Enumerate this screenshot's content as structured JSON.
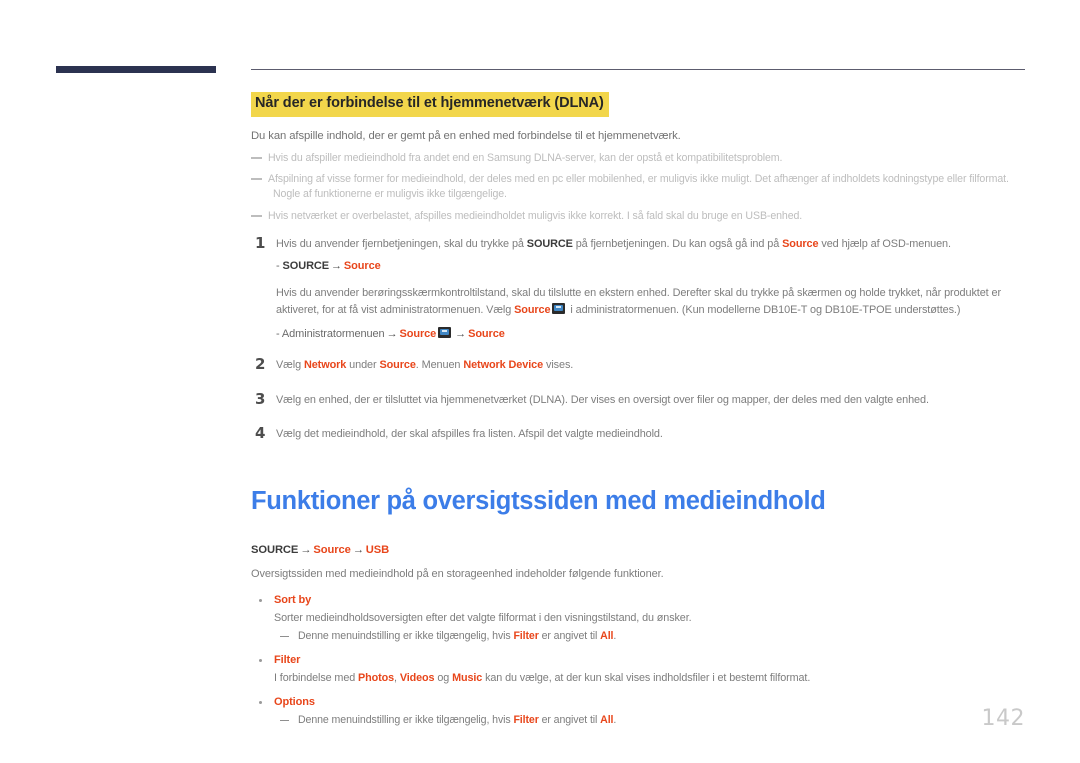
{
  "colors": {
    "highlight_yellow": "#f2d64b",
    "accent_red": "#e8461b",
    "title_blue": "#3c7de8",
    "bar_navy": "#2b3250",
    "body_gray": "#7d7d7d",
    "note_gray": "#bdbdbd",
    "page_num_gray": "#c9c9c9"
  },
  "section": {
    "heading": "Når der er forbindelse til et hjemmenetværk (DLNA)",
    "lead": "Du kan afspille indhold, der er gemt på en enhed med forbindelse til et hjemmenetværk.",
    "notes": [
      {
        "line1": "Hvis du afspiller medieindhold fra andet end en Samsung DLNA-server, kan der opstå et kompatibilitetsproblem.",
        "line2": ""
      },
      {
        "line1": "Afspilning af visse former for medieindhold, der deles med en pc eller mobilenhed, er muligvis ikke muligt. Det afhænger af indholdets kodningstype eller filformat.",
        "line2": "Nogle af funktionerne er muligvis ikke tilgængelige."
      },
      {
        "line1": "Hvis netværket er overbelastet, afspilles medieindholdet muligvis ikke korrekt. I så fald skal du bruge en USB-enhed.",
        "line2": ""
      }
    ]
  },
  "steps": {
    "step1": {
      "num": "1",
      "t1": "Hvis du anvender fjernbetjeningen, skal du trykke på ",
      "kw1": "SOURCE",
      "t2": " på fjernbetjeningen. Du kan også gå ind på ",
      "kw2": "Source",
      "t3": " ved hjælp af OSD-menuen.",
      "path_dash": "-",
      "path_a": "SOURCE",
      "path_arrow": "→",
      "path_b": "Source",
      "sub1": "Hvis du anvender berøringsskærmkontroltilstand, skal du tilslutte en ekstern enhed. Derefter skal du trykke på skærmen og holde trykket, når produktet er aktiveret, for at få vist administratormenuen. Vælg ",
      "sub_kw": "Source",
      "sub2": " i administratormenuen. (Kun modellerne DB10E-T og DB10E-TPOE understøttes.)",
      "path2_dash": "- Administratormenuen",
      "path2_arrow1": "→",
      "path2_a": "Source",
      "path2_arrow2": "→",
      "path2_b": "Source"
    },
    "step2": {
      "num": "2",
      "t1": "Vælg ",
      "kw1": "Network",
      "t2": " under ",
      "kw2": "Source",
      "t3": ". Menuen ",
      "kw3": "Network Device",
      "t4": " vises."
    },
    "step3": {
      "num": "3",
      "text": "Vælg en enhed, der er tilsluttet via hjemmenetværket (DLNA). Der vises en oversigt over filer og mapper, der deles med den valgte enhed."
    },
    "step4": {
      "num": "4",
      "text": "Vælg det medieindhold, der skal afspilles fra listen. Afspil det valgte medieindhold."
    }
  },
  "main": {
    "title": "Funktioner på oversigtssiden med medieindhold",
    "path": {
      "a": "SOURCE",
      "arrow1": "→",
      "b": "Source",
      "arrow2": "→",
      "c": "USB"
    },
    "intro": "Oversigtssiden med medieindhold på en storageenhed indeholder følgende funktioner.",
    "features": [
      {
        "title": "Sort by",
        "desc": "Sorter medieindholdsoversigten efter det valgte filformat i den visningstilstand, du ønsker.",
        "sub_pre": "Denne menuindstilling er ikke tilgængelig, hvis ",
        "sub_kw1": "Filter",
        "sub_mid": " er angivet til ",
        "sub_kw2": "All",
        "sub_post": "."
      },
      {
        "title": "Filter",
        "desc_pre": "I forbindelse med ",
        "desc_kw1": "Photos",
        "desc_sep1": ", ",
        "desc_kw2": "Videos",
        "desc_sep2": " og ",
        "desc_kw3": "Music",
        "desc_post": " kan du vælge, at der kun skal vises indholdsfiler i et bestemt filformat."
      },
      {
        "title": "Options",
        "sub_pre": "Denne menuindstilling er ikke tilgængelig, hvis ",
        "sub_kw1": "Filter",
        "sub_mid": " er angivet til ",
        "sub_kw2": "All",
        "sub_post": "."
      }
    ]
  },
  "footer": {
    "page_number": "142"
  }
}
